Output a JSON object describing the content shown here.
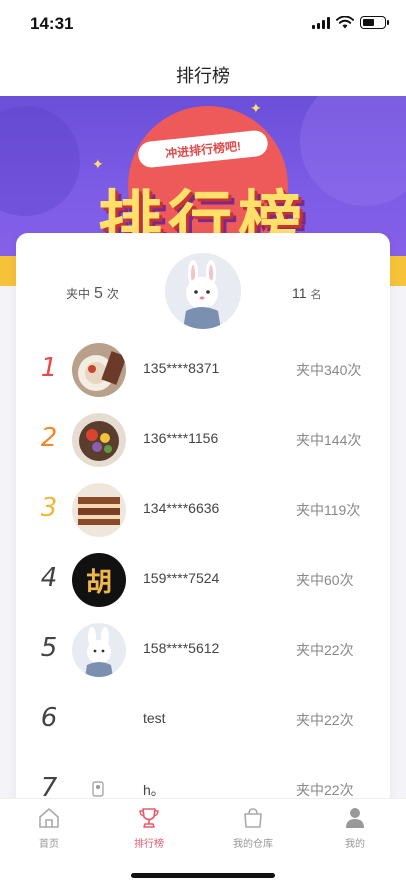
{
  "status": {
    "time": "14:31"
  },
  "nav": {
    "title": "排行榜"
  },
  "banner": {
    "ribbon": "冲进排行榜吧!",
    "title": "排行榜"
  },
  "me": {
    "hits_label": "夹中",
    "hits_value": "5",
    "hits_unit": "次",
    "rank_value": "11",
    "rank_unit": "名"
  },
  "rankings": [
    {
      "rank": "1",
      "name": "135****8371",
      "count": "夹中340次",
      "color": "#e84a4a",
      "avatar": "food-plate"
    },
    {
      "rank": "2",
      "name": "136****1156",
      "count": "夹中144次",
      "color": "#f08a2c",
      "avatar": "flower-dish"
    },
    {
      "rank": "3",
      "name": "134****6636",
      "count": "夹中119次",
      "color": "#f2b733",
      "avatar": "cake"
    },
    {
      "rank": "4",
      "name": "159****7524",
      "count": "夹中60次",
      "color": "#444444",
      "avatar": "hu-character"
    },
    {
      "rank": "5",
      "name": "158****5612",
      "count": "夹中22次",
      "color": "#444444",
      "avatar": "bunny"
    },
    {
      "rank": "6",
      "name": "test",
      "count": "夹中22次",
      "color": "#444444",
      "avatar": ""
    },
    {
      "rank": "7",
      "name": "h。",
      "count": "夹中22次",
      "color": "#444444",
      "avatar": "small-icon"
    }
  ],
  "avatar_char": "胡",
  "tabs": [
    {
      "label": "首页",
      "icon": "home-icon",
      "active": false
    },
    {
      "label": "排行榜",
      "icon": "trophy-icon",
      "active": true
    },
    {
      "label": "我的仓库",
      "icon": "bag-icon",
      "active": false
    },
    {
      "label": "我的",
      "icon": "user-icon",
      "active": false
    }
  ],
  "colors": {
    "accent": "#e95a6e",
    "banner": "#7d5ce6",
    "banner_stripe": "#f6c23a"
  }
}
